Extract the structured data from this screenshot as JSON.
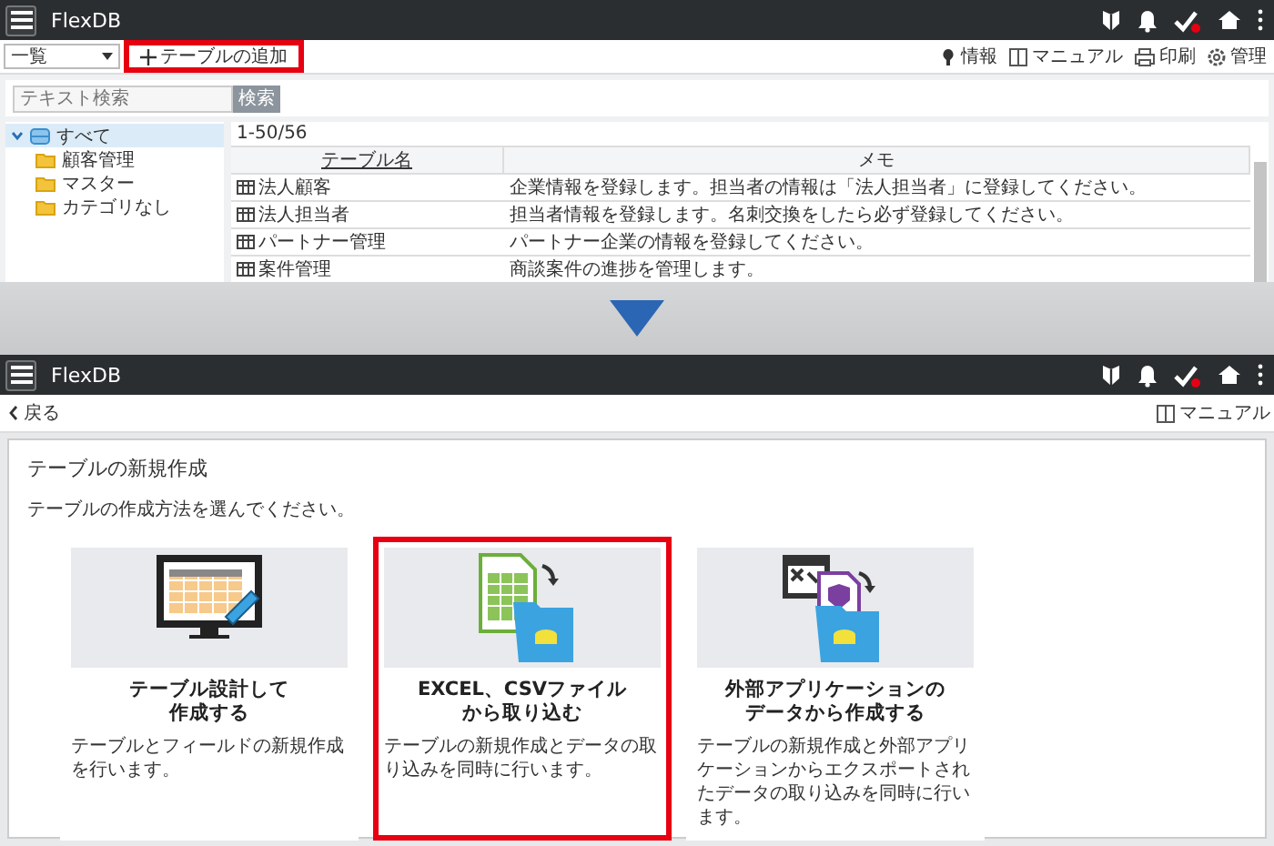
{
  "top_screen": {
    "app_title": "FlexDB",
    "view_select": "一覧",
    "add_button": {
      "label": "テーブルの追加",
      "highlighted": true
    },
    "toolbar_links": [
      {
        "kind": "info",
        "label": "情報"
      },
      {
        "kind": "manual",
        "label": "マニュアル"
      },
      {
        "kind": "print",
        "label": "印刷"
      },
      {
        "kind": "settings",
        "label": "管理"
      }
    ],
    "search": {
      "placeholder": "テキスト検索",
      "button": "検索"
    },
    "tree": [
      {
        "kind": "database",
        "label": "すべて",
        "expanded": true,
        "selected": true,
        "children": [
          {
            "kind": "folder",
            "label": "顧客管理",
            "selected": false
          },
          {
            "kind": "folder",
            "label": "マスター",
            "selected": false
          },
          {
            "kind": "folder",
            "label": "カテゴリなし",
            "selected": false
          }
        ]
      }
    ],
    "table": {
      "count": "1-50/56",
      "columns": [
        "テーブル名",
        "メモ"
      ],
      "rows": [
        {
          "name": "法人顧客",
          "memo": "企業情報を登録します。担当者の情報は「法人担当者」に登録してください。"
        },
        {
          "name": "法人担当者",
          "memo": "担当者情報を登録します。名刺交換をしたら必ず登録してください。"
        },
        {
          "name": "パートナー管理",
          "memo": "パートナー企業の情報を登録してください。"
        },
        {
          "name": "案件管理",
          "memo": "商談案件の進捗を管理します。"
        }
      ]
    }
  },
  "bottom_screen": {
    "app_title": "FlexDB",
    "back_link": "戻る",
    "manual_link": "マニュアル",
    "heading": "テーブルの新規作成",
    "instruction": "テーブルの作成方法を選んでください。",
    "options": [
      {
        "kind": "design",
        "title_lines": [
          "テーブル設計して",
          "作成する"
        ],
        "description": "テーブルとフィールドの新規作成を行います。",
        "selected": false
      },
      {
        "kind": "import_file",
        "title_lines": [
          "EXCEL、CSVファイル",
          "から取り込む"
        ],
        "description": "テーブルの新規作成とデータの取り込みを同時に行います。",
        "selected": true
      },
      {
        "kind": "external_app",
        "title_lines": [
          "外部アプリケーションの",
          "データから作成する"
        ],
        "description": "テーブルの新規作成と外部アプリケーションからエクスポートされたデータの取り込みを同時に行います。",
        "selected": false
      }
    ]
  }
}
